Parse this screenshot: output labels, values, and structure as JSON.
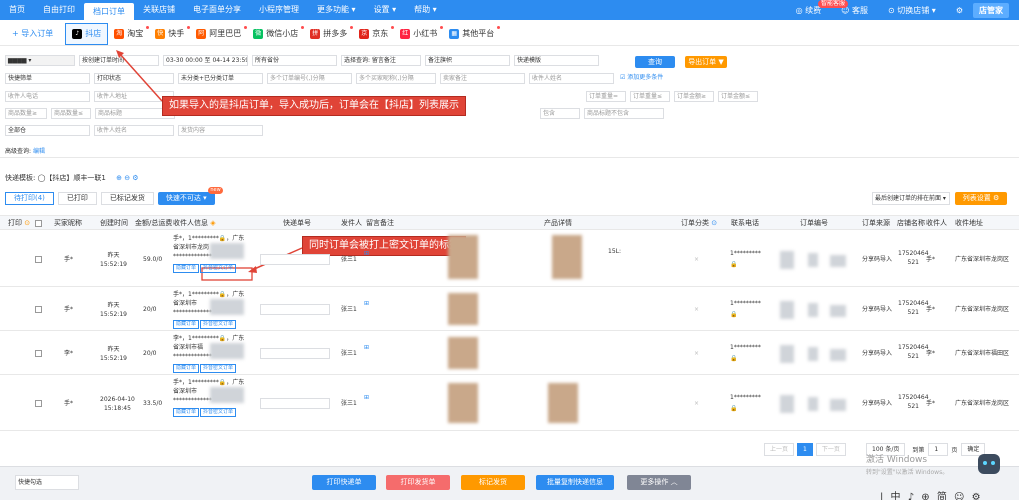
{
  "topnav": {
    "items": [
      "首页",
      "自由打印",
      "档口订单",
      "关联店铺",
      "电子面单分享",
      "小程序管理",
      "更多功能 ▾",
      "设置 ▾",
      "帮助 ▾"
    ],
    "right": [
      "续费",
      "客服",
      "切换店铺 ▾"
    ],
    "badge": "智能客服",
    "logo": "店管家"
  },
  "platbar": {
    "import": "+ 导入订单",
    "tabs": [
      {
        "name": "抖店",
        "icon": "♪",
        "color": "#000000"
      },
      {
        "name": "淘宝",
        "icon": "淘",
        "color": "#ff5000"
      },
      {
        "name": "快手",
        "icon": "快",
        "color": "#ff7f00"
      },
      {
        "name": "阿里巴巴",
        "icon": "阿",
        "color": "#ff5a00"
      },
      {
        "name": "微信小店",
        "icon": "微",
        "color": "#07c160"
      },
      {
        "name": "拼多多",
        "icon": "拼",
        "color": "#e02e24"
      },
      {
        "name": "京东",
        "icon": "京",
        "color": "#e1251b"
      },
      {
        "name": "小红书",
        "icon": "红",
        "color": "#ff2442"
      },
      {
        "name": "其他平台",
        "icon": "▦",
        "color": "#2d8cf0"
      }
    ]
  },
  "filters": {
    "row1": [
      "按创建订单时间",
      "03-30 00:00 至 04-14 23:59",
      "所有省份",
      "选择查询: 留言备注",
      "备注旗帜",
      "快递模版"
    ],
    "row2": [
      "快捷筛单",
      "打印状态",
      "未分类+已分类订单",
      "多个订单编号(,)分隔",
      "多个买家昵称(,)分隔",
      "卖家备注",
      "收件人姓名",
      "添加更多条件"
    ],
    "row3": [
      "收件人电话",
      "收件人地址",
      "订单重量=",
      "订单重量≤",
      "订单金额≥",
      "订单金额≤"
    ],
    "row4": [
      "商品数量≥",
      "商品数量≤",
      "商品标题",
      "包含",
      "商品标题不包含"
    ],
    "row5": [
      "全部仓",
      "收件人姓名",
      "发货内容"
    ],
    "query": "查询",
    "export": "导出订单 ▼",
    "advanced": "高级查询:",
    "edit": "编辑"
  },
  "callout1": "如果导入的是抖店订单，导入成功后，订单会在【抖店】列表展示",
  "callout2": "同时订单会被打上密文订单的标签",
  "express": {
    "label": "快递模板:",
    "value": "◯【抖店】顺丰一联1"
  },
  "statetabs": [
    "待打印(4)",
    "已打印",
    "已标记发货"
  ],
  "quick_send": "快速不可达",
  "new": "new",
  "sort": "最后创建订单的排在前面 ▾",
  "listsetting": "列表设置",
  "table": {
    "headers": [
      "打印",
      "买家昵称",
      "创建时间",
      "金额/总运费",
      "收件人信息",
      "快递单号",
      "发件人",
      "留言备注",
      "产品详情",
      "订单分类",
      "联系电话",
      "订单编号",
      "订单来源",
      "店铺名称",
      "收件人",
      "收件地址"
    ],
    "rows": [
      {
        "nick": "手*",
        "time": "昨天\n15:52:19",
        "amount": "59.0/0",
        "info1": "手*，1*********🔒，广东",
        "info2": "省深圳市龙岗",
        "info3": "*************",
        "sender": "张三1",
        "phone": "1*********",
        "source": "分享码导入",
        "shop": "17520464\n521",
        "recv": "手*",
        "addr": "广东省深圳市龙岗区",
        "extra": "15L:"
      },
      {
        "nick": "手*",
        "time": "昨天\n15:52:19",
        "amount": "20/0",
        "info1": "手*，1*********🔒，广东",
        "info2": "省深圳市",
        "info3": "*************",
        "sender": "张三1",
        "phone": "1*********",
        "source": "分享码导入",
        "shop": "17520464\n521",
        "recv": "手*",
        "addr": "广东省深圳市龙岗区",
        "extra": ""
      },
      {
        "nick": "李*",
        "time": "昨天\n15:52:19",
        "amount": "20/0",
        "info1": "李*，1*********🔒，广东",
        "info2": "省深圳市福",
        "info3": "*************",
        "sender": "张三1",
        "phone": "1*********",
        "source": "分享码导入",
        "shop": "17520464\n521",
        "recv": "李*",
        "addr": "广东省深圳市福田区",
        "extra": ""
      },
      {
        "nick": "手*",
        "time": "2026-04-10\n15:18:45",
        "amount": "33.5/0",
        "info1": "手*，1*********🔒，广东",
        "info2": "省深圳市",
        "info3": "*************",
        "sender": "张三1",
        "phone": "1*********",
        "source": "分享码导入",
        "shop": "17520464\n521",
        "recv": "手*",
        "addr": "广东省深圳市龙岗区",
        "extra": ""
      }
    ],
    "tag1": "隐藏订单",
    "tag2": "抖音密文订单"
  },
  "pager": {
    "prev": "上一页",
    "page": "1",
    "next": "下一页",
    "size": "100 条/页",
    "goto": "到第",
    "page_input": "1",
    "unit": "页",
    "confirm": "确定"
  },
  "bottom": {
    "select": "快捷勾选",
    "buttons": [
      {
        "label": "打印快递单",
        "color": "#2d8cf0"
      },
      {
        "label": "打印发货单",
        "color": "#f56c6c"
      },
      {
        "label": "标记发货",
        "color": "#ff9900"
      },
      {
        "label": "批量复制快递信息",
        "color": "#2d8cf0"
      },
      {
        "label": "更多操作 ︿",
        "color": "#808695"
      }
    ]
  },
  "watermark": {
    "l1": "激活 Windows",
    "l2": "转到\"设置\"以激活 Windows。"
  },
  "taskbar": "| 中 ♪ ⊕ 简 ☺ ⚙"
}
